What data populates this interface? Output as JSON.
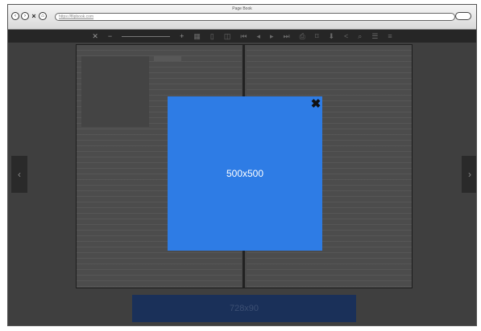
{
  "window": {
    "title": "Page Book"
  },
  "addressbar": {
    "url": "https://flipbook.com"
  },
  "toolbar": {
    "items": [
      {
        "icon": "fullscreen-icon",
        "glyph": "✕"
      },
      {
        "icon": "zoom-out-icon",
        "glyph": "−"
      },
      {
        "icon": "zoom-in-icon",
        "glyph": "+"
      },
      {
        "icon": "thumbnails-icon",
        "glyph": "▦"
      },
      {
        "icon": "single-page-icon",
        "glyph": "▯"
      },
      {
        "icon": "double-page-icon",
        "glyph": "◫"
      },
      {
        "icon": "first-page-icon",
        "glyph": "⏮"
      },
      {
        "icon": "prev-page-icon",
        "glyph": "◂"
      },
      {
        "icon": "next-page-icon",
        "glyph": "▸"
      },
      {
        "icon": "last-page-icon",
        "glyph": "⏭"
      },
      {
        "icon": "print-icon",
        "glyph": "⎙"
      },
      {
        "icon": "bookmark-icon",
        "glyph": "⌑"
      },
      {
        "icon": "download-icon",
        "glyph": "⬇"
      },
      {
        "icon": "share-icon",
        "glyph": "<"
      },
      {
        "icon": "search-icon",
        "glyph": "⌕"
      },
      {
        "icon": "list-icon",
        "glyph": "☰"
      },
      {
        "icon": "menu-icon",
        "glyph": "≡"
      }
    ]
  },
  "nav": {
    "prev_glyph": "‹",
    "next_glyph": "›"
  },
  "ad_modal": {
    "label": "500x500",
    "close_glyph": "✖",
    "color": "#2e7ce5"
  },
  "banner": {
    "label": "728x90",
    "color": "#1a3059"
  }
}
